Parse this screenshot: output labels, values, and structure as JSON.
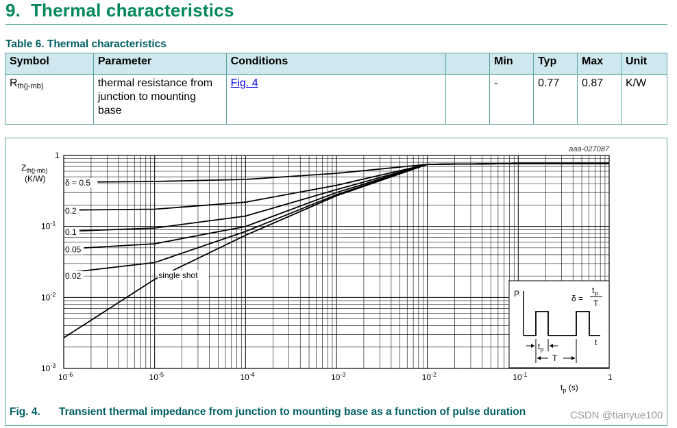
{
  "section": {
    "number": "9.",
    "title": "Thermal characteristics"
  },
  "table": {
    "caption": "Table 6. Thermal characteristics",
    "headers": [
      "Symbol",
      "Parameter",
      "Conditions",
      "",
      "Min",
      "Typ",
      "Max",
      "Unit"
    ],
    "row": {
      "symbol_main": "R",
      "symbol_sub": "th(j-mb)",
      "parameter": "thermal resistance from junction to mounting base",
      "conditions": "Fig. 4",
      "min": "-",
      "typ": "0.77",
      "max": "0.87",
      "unit": "K/W"
    }
  },
  "figure": {
    "id": "aaa-027087",
    "caption_number": "Fig. 4.",
    "caption_text": "Transient thermal impedance from junction to mounting base as a function of pulse duration"
  },
  "watermark": "CSDN @tianyue100",
  "chart_data": {
    "type": "line",
    "log_x": true,
    "log_y": true,
    "xlim": [
      1e-06,
      1
    ],
    "ylim": [
      0.001,
      1
    ],
    "x_ticks": [
      {
        "base": "10",
        "exp": "-6"
      },
      {
        "base": "10",
        "exp": "-5"
      },
      {
        "base": "10",
        "exp": "-4"
      },
      {
        "base": "10",
        "exp": "-3"
      },
      {
        "base": "10",
        "exp": "-2"
      },
      {
        "base": "10",
        "exp": "-1"
      },
      {
        "base": "1",
        "exp": ""
      }
    ],
    "y_ticks": [
      {
        "base": "1",
        "exp": ""
      },
      {
        "base": "10",
        "exp": "-1"
      },
      {
        "base": "10",
        "exp": "-2"
      },
      {
        "base": "10",
        "exp": "-3"
      }
    ],
    "xlabel": {
      "main": "t",
      "sub": "p",
      "unit": " (s)"
    },
    "ylabel": {
      "main": "Z",
      "sub": "th(j-mb)",
      "unit": "(K/W)"
    },
    "grid": true,
    "series": [
      {
        "name": "δ = 0.5",
        "x": [
          1e-06,
          1e-05,
          0.0001,
          0.001,
          0.01,
          0.1,
          1
        ],
        "y": [
          0.42,
          0.43,
          0.46,
          0.56,
          0.75,
          0.77,
          0.77
        ]
      },
      {
        "name": "0.2",
        "x": [
          1e-06,
          1e-05,
          0.0001,
          0.001,
          0.01,
          0.1,
          1
        ],
        "y": [
          0.17,
          0.175,
          0.22,
          0.38,
          0.75,
          0.77,
          0.77
        ]
      },
      {
        "name": "0.1",
        "x": [
          1e-06,
          1e-05,
          0.0001,
          0.001,
          0.01,
          0.1,
          1
        ],
        "y": [
          0.085,
          0.095,
          0.14,
          0.33,
          0.75,
          0.77,
          0.77
        ]
      },
      {
        "name": "0.05",
        "x": [
          1e-06,
          1e-05,
          0.0001,
          0.001,
          0.01,
          0.1,
          1
        ],
        "y": [
          0.048,
          0.057,
          0.1,
          0.3,
          0.75,
          0.77,
          0.77
        ]
      },
      {
        "name": "0.02",
        "x": [
          1e-06,
          1e-05,
          0.0001,
          0.001,
          0.01,
          0.1,
          1
        ],
        "y": [
          0.022,
          0.031,
          0.085,
          0.28,
          0.75,
          0.77,
          0.77
        ]
      },
      {
        "name": "single shot",
        "x": [
          1e-06,
          1e-05,
          0.0001,
          0.001,
          0.01,
          0.1,
          1
        ],
        "y": [
          0.0027,
          0.018,
          0.075,
          0.27,
          0.75,
          0.77,
          0.77
        ]
      }
    ],
    "inset": {
      "p_label": "P",
      "t_label": "t",
      "tp_label": {
        "main": "t",
        "sub": "p"
      },
      "T_label": "T",
      "delta_label": "δ =",
      "fraction_num": {
        "main": "t",
        "sub": "p"
      },
      "fraction_den": "T"
    }
  }
}
